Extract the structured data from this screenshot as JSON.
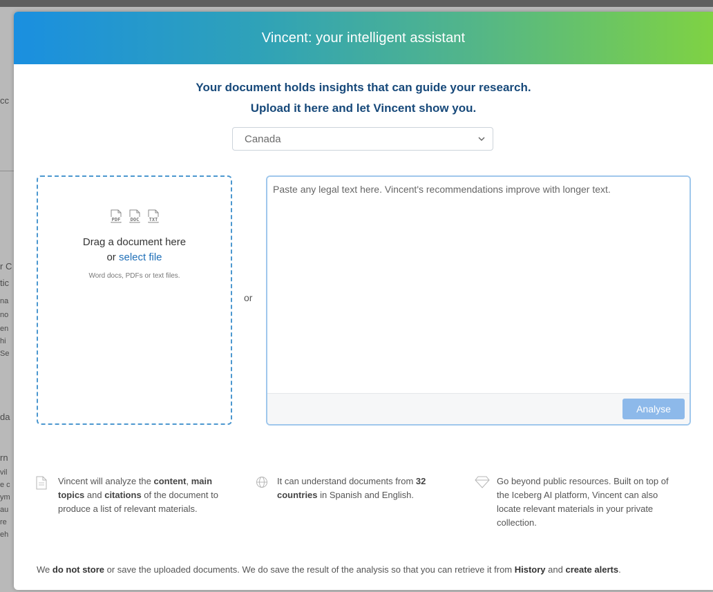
{
  "background": {
    "fragments": [
      "cc",
      "r C",
      "tic",
      "na",
      "no",
      "en",
      "hi",
      "Se",
      "da",
      "rn",
      "vil",
      "e c",
      "ym",
      "au",
      "re",
      "eh"
    ]
  },
  "modal": {
    "title": "Vincent: your intelligent assistant",
    "intro_line1": "Your document holds insights that can guide your research.",
    "intro_line2": "Upload it here and let Vincent show you.",
    "country_select": {
      "value": "Canada"
    },
    "upload": {
      "file_icons": [
        "PDF",
        "DOC",
        "TXT"
      ],
      "drag_text": "Drag a document here",
      "or_prefix": "or",
      "select_file": "select file",
      "types_text": "Word docs, PDFs or text files."
    },
    "or_separator": "or",
    "paste": {
      "placeholder": "Paste any legal text here. Vincent's recommendations improve with longer text.",
      "button": "Analyse"
    },
    "features": [
      {
        "icon": "document-icon",
        "parts": [
          "Vincent will analyze the ",
          "content",
          ", ",
          "main topics",
          " and ",
          "citations",
          " of the document to produce a list of relevant materials."
        ]
      },
      {
        "icon": "globe-icon",
        "parts": [
          "It can understand documents from ",
          "32 countries",
          " in Spanish and English."
        ]
      },
      {
        "icon": "diamond-icon",
        "parts": [
          "Go beyond public resources. Built on top of the Iceberg AI platform, Vincent can also locate relevant materials in your private collection."
        ]
      }
    ],
    "footer": {
      "parts": [
        "We ",
        "do not store",
        " or save the uploaded documents. We do save the result of the analysis so that you can retrieve it from ",
        "History",
        " and ",
        "create alerts",
        "."
      ]
    }
  },
  "colors": {
    "header_gradient_start": "#1a8fe0",
    "header_gradient_end": "#7fd243",
    "title_blue": "#17497a",
    "link_blue": "#1f6fb8",
    "button_blue": "#8db9ea"
  }
}
